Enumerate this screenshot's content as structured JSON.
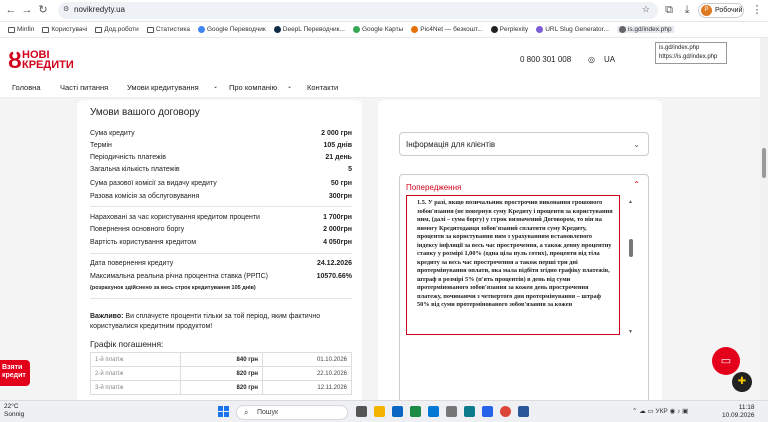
{
  "browser": {
    "url": "novikredyty.ua",
    "profile_label": "Робочий",
    "profile_initial": "Р",
    "bookmarks": [
      "Minfin",
      "Користувачі",
      "Дод.роботи",
      "Статистика",
      "Google Переводчик",
      "DeepL Переводчик...",
      "Google Карты",
      "Pic4Net — безкошт...",
      "Perplexity",
      "URL Slug Generator...",
      "is.gd/index.php"
    ],
    "tooltip_line1": "is.gd/index.php",
    "tooltip_line2": "https://is.gd/index.php"
  },
  "header": {
    "logo_line1": "НОВІ",
    "logo_line2": "КРЕДИТИ",
    "phone": "0 800 301 008",
    "lang": "UA"
  },
  "nav": [
    "Головна",
    "Часті питання",
    "Умови кредитування",
    "Про компанію",
    "Контакти"
  ],
  "contract": {
    "title": "Умови вашого договору",
    "rows1": [
      {
        "label": "Сума кредиту",
        "value": "2 000 грн"
      },
      {
        "label": "Термін",
        "value": "105 днів"
      },
      {
        "label": "Періодичність платежів",
        "value": "21 день"
      },
      {
        "label": "Загальна кількість платежів",
        "value": "5"
      },
      {
        "label": "Сума разової комісії за видачу кредиту",
        "value": "50 грн"
      },
      {
        "label": "Разова комісія за обслуговування",
        "value": "300грн"
      }
    ],
    "rows2": [
      {
        "label": "Нараховані за час користування кредитом проценти",
        "value": "1 700грн"
      },
      {
        "label": "Повернення основного боргу",
        "value": "2 000грн"
      },
      {
        "label": "Вартість користування кредитом",
        "value": "4 050грн"
      }
    ],
    "rows3": [
      {
        "label": "Дата повернення кредиту",
        "value": "24.12.2026"
      },
      {
        "label": "Максимальна реальна річна процентна ставка (РРПС)",
        "value": "10570.66%"
      }
    ],
    "rrps_note": "(розрахунок здійснено за весь строк кредитування 105 днів)",
    "important_bold": "Важливо:",
    "important_text": " Ви сплачуєте проценти тільки за той період, яким фактично користувалися кредитним продуктом!",
    "schedule_title": "Графік погашення:",
    "schedule": [
      {
        "n": "1-й платіж",
        "sum": "840 грн",
        "date": "01.10.2026"
      },
      {
        "n": "2-й платіж",
        "sum": "820 грн",
        "date": "22.10.2026"
      },
      {
        "n": "3-й платіж",
        "sum": "820 грн",
        "date": "12.11.2026"
      }
    ]
  },
  "info": {
    "acc1_title": "Інформація для клієнтів",
    "acc2_title": "Попередження",
    "warning_text": "1.5. У разі, якщо позичальник прострочив виконання грошового зобов'язання (не повернув суму Кредиту і проценти за користування ним, (далі – сума боргу) у строк визначений Договором, то він на вимогу Кредитодавця зобов'язаний сплатити суму Кредиту, проценти за користування ним з урахуванням встановленого індексу інфляції за весь час прострочення, а також денну процентну ставку у розмірі 1,00% (одна ціла нуль сотих), проценти від тіла кредиту за весь час прострочення а також перші три дні протермінування оплати, яка мала відбітя згідно графіку платежів, штраф в розмірі 5% (п'ять процентів) в день від суми протермінованого зобов'язання за кожен день прострочення платежу, починаючи з четвертого дня протермінування – штраф 50% від суми протермінованого зобов'язання за кожен"
  },
  "floating": {
    "take_credit": "Взяти кредит"
  },
  "taskbar": {
    "temp": "22°C",
    "weather": "Sonnig",
    "search_placeholder": "Пошук",
    "lang": "УКР",
    "time": "11:18",
    "date": "10.09.2026"
  }
}
